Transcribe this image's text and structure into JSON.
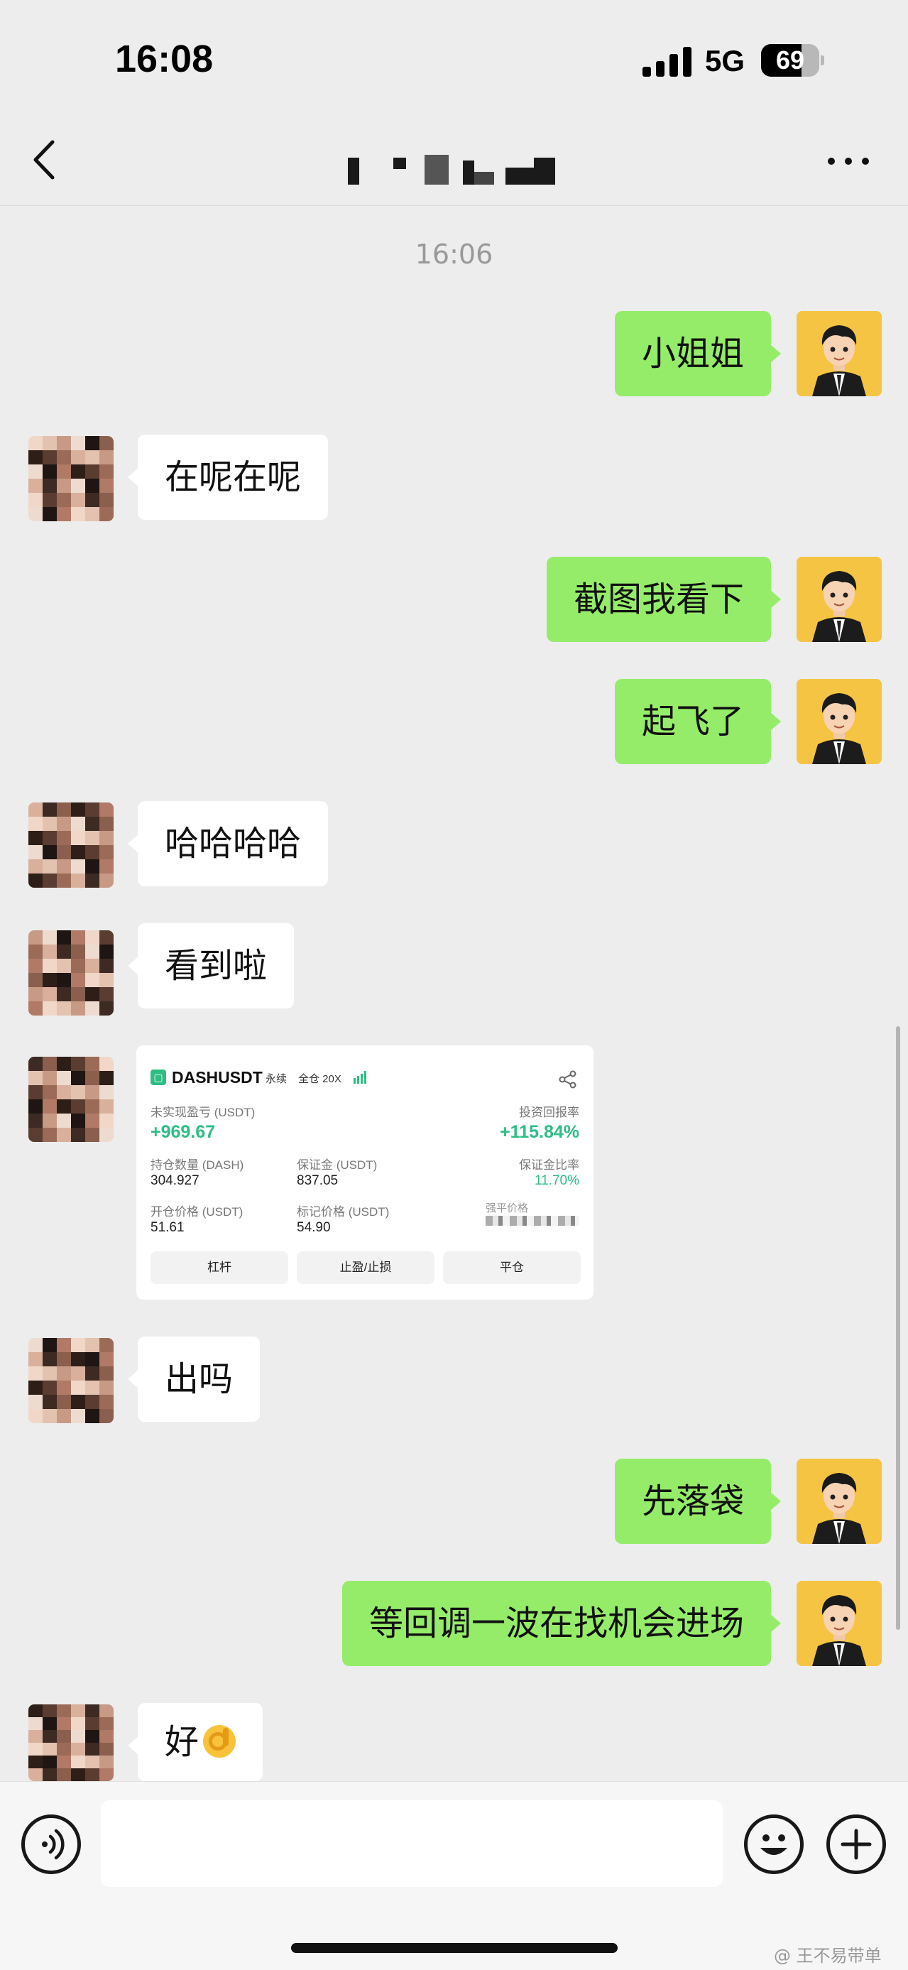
{
  "status_bar": {
    "time": "16:08",
    "network": "5G",
    "battery": "69",
    "battery_level": 0.69
  },
  "nav": {
    "title": ""
  },
  "chat": {
    "timestamp": "16:06",
    "messages": [
      {
        "from": "me",
        "text": "小姐姐"
      },
      {
        "from": "them",
        "text": "在呢在呢"
      },
      {
        "from": "me",
        "text": "截图我看下"
      },
      {
        "from": "me",
        "text": "起飞了"
      },
      {
        "from": "them",
        "text": "哈哈哈哈"
      },
      {
        "from": "them",
        "text": "看到啦"
      },
      {
        "from": "them",
        "type": "image"
      },
      {
        "from": "them",
        "text": "出吗"
      },
      {
        "from": "me",
        "text": "先落袋"
      },
      {
        "from": "me",
        "text": "等回调一波在找机会进场"
      },
      {
        "from": "them",
        "text": "好",
        "emoji": "ok-hand"
      }
    ]
  },
  "trade_card": {
    "symbol": "DASHUSDT",
    "tag_perpetual": "永续",
    "tag_margin": "全仓 20X",
    "unrealized_pnl_label": "未实现盈亏 (USDT)",
    "unrealized_pnl": "+969.67",
    "roe_label": "投资回报率",
    "roe": "+115.84%",
    "position_label": "持仓数量 (DASH)",
    "position": "304.927",
    "margin_label": "保证金 (USDT)",
    "margin": "837.05",
    "margin_ratio_label": "保证金比率",
    "margin_ratio": "11.70%",
    "entry_price_label": "开仓价格 (USDT)",
    "entry_price": "51.61",
    "mark_price_label": "标记价格 (USDT)",
    "mark_price": "54.90",
    "liq_price_label": "强平价格",
    "btn_leverage": "杠杆",
    "btn_tpsl": "止盈/止损",
    "btn_close": "平仓",
    "accent": "#2ebd85"
  },
  "input": {
    "placeholder": ""
  },
  "watermark": "@ 王不易带单",
  "colors": {
    "me_bubble": "#95ec69",
    "them_bubble": "#ffffff",
    "background": "#ededed"
  }
}
